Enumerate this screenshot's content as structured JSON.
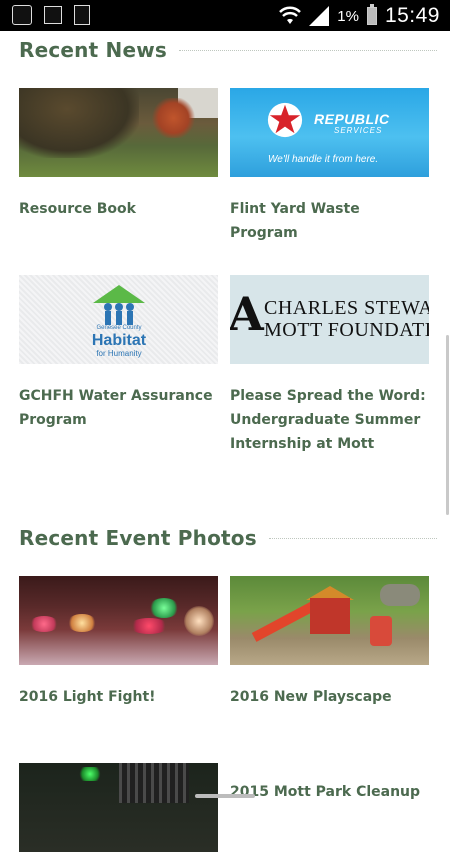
{
  "status_bar": {
    "battery_percent": "1%",
    "time": "15:49",
    "icons": [
      "app-icon",
      "gallery-icon",
      "clipboard-icon",
      "wifi-icon",
      "signal-icon",
      "battery-icon"
    ]
  },
  "recent_news": {
    "title": "Recent News",
    "items": [
      {
        "title": "Resource Book",
        "image": "autumn-park-photo"
      },
      {
        "title": "Flint Yard Waste Program",
        "image": "republic-services-logo",
        "logo_text": "REPUBLIC",
        "logo_sub": "SERVICES",
        "tagline": "We'll handle it from here."
      },
      {
        "title": "GCHFH Water Assurance Program",
        "image": "habitat-for-humanity-logo",
        "logo_small": "Genesee County",
        "logo_big": "Habitat",
        "logo_sub": "for Humanity"
      },
      {
        "title": "Please Spread the Word: Undergraduate Summer Internship at Mott",
        "image": "mott-foundation-logo",
        "logo_line1": "CHARLES STEWA",
        "logo_line2": "MOTT FOUNDATI"
      }
    ]
  },
  "recent_event_photos": {
    "title": "Recent Event Photos",
    "items": [
      {
        "title": "2016 Light Fight!",
        "image": "holiday-lights-photo"
      },
      {
        "title": "2016 New Playscape",
        "image": "playground-photo"
      },
      {
        "title": "",
        "image": "night-park-photo"
      },
      {
        "title": "2015 Mott Park Cleanup",
        "image": ""
      }
    ]
  },
  "colors": {
    "heading": "#4c6a4f",
    "status_bar": "#000000",
    "republic_blue": "#2aa7e6",
    "habitat_blue": "#2c75b4"
  }
}
